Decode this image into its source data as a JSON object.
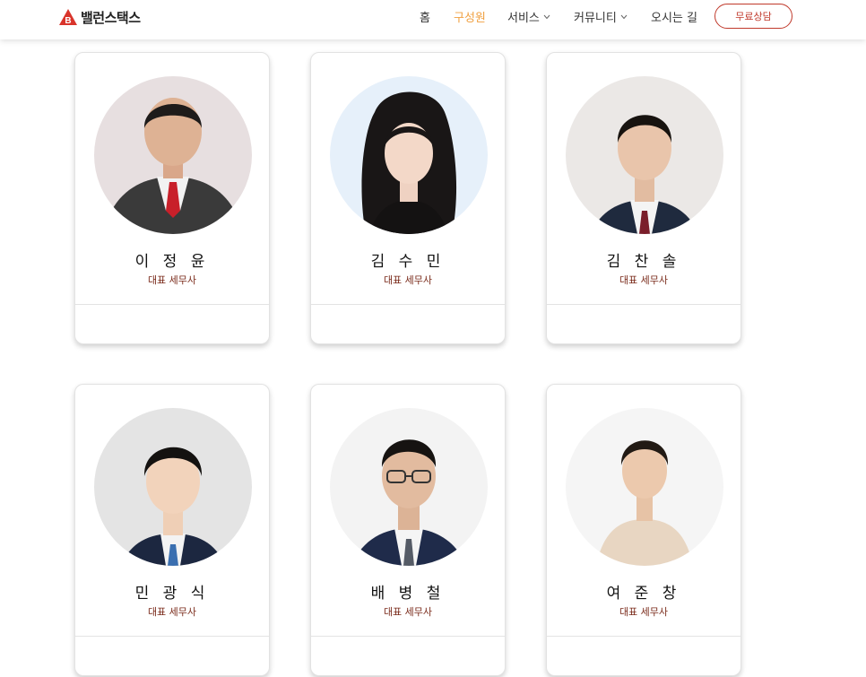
{
  "header": {
    "logo_text": "밸런스택스",
    "nav": [
      {
        "label": "홈",
        "has_dropdown": false,
        "active": false
      },
      {
        "label": "구성원",
        "has_dropdown": false,
        "active": true
      },
      {
        "label": "서비스",
        "has_dropdown": true,
        "active": false
      },
      {
        "label": "커뮤니티",
        "has_dropdown": true,
        "active": false
      },
      {
        "label": "오시는 길",
        "has_dropdown": false,
        "active": false
      }
    ],
    "cta_label": "무료상담"
  },
  "colors": {
    "accent_active": "#f0a040",
    "brand_red": "#c0392b"
  },
  "members": [
    {
      "name": "이 정 윤",
      "role": "대표 세무사"
    },
    {
      "name": "김 수 민",
      "role": "대표 세무사"
    },
    {
      "name": "김 찬 솔",
      "role": "대표 세무사"
    },
    {
      "name": "민 광 식",
      "role": "대표 세무사"
    },
    {
      "name": "배 병 철",
      "role": "대표 세무사"
    },
    {
      "name": "여 준 창",
      "role": "대표 세무사"
    }
  ]
}
